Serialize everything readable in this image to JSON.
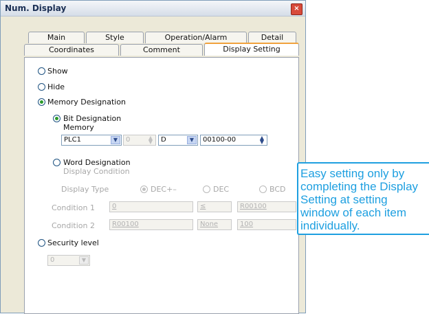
{
  "window": {
    "title": "Num. Display",
    "close_glyph": "×"
  },
  "tabs_row1": [
    "Main",
    "Style",
    "Operation/Alarm",
    "Detail"
  ],
  "tabs_row2": [
    "Coordinates",
    "Comment",
    "Display Setting"
  ],
  "active_tab": "Display Setting",
  "display": {
    "show": "Show",
    "hide": "Hide",
    "memory_designation": "Memory Designation",
    "selected": "Memory Designation"
  },
  "bit": {
    "label": "Bit Designation",
    "memory_label": "Memory",
    "plc": "PLC1",
    "station": "0",
    "device": "D",
    "address": "00100-00"
  },
  "word": {
    "label": "Word Designation",
    "display_condition": "Display Condition",
    "display_type_label": "Display Type",
    "types": [
      "DEC+–",
      "DEC",
      "BCD"
    ],
    "selected_type": "DEC+–",
    "cond1_label": "Condition 1",
    "cond1_value": "0",
    "cond1_op": "≤",
    "cond1_ref": "R00100",
    "cond2_label": "Condition 2",
    "cond2_value": "R00100",
    "cond2_op": "None",
    "cond2_ref": "100"
  },
  "security": {
    "label": "Security level",
    "value": "0"
  },
  "callout": "Easy setting only by\ncompleting the Display\nSetting at setting\nwindow of each item\nindividually.",
  "colors": {
    "accent_tab": "#f0a23c",
    "callout": "#1d9fe0",
    "radio_dot": "#2b9a2b"
  }
}
